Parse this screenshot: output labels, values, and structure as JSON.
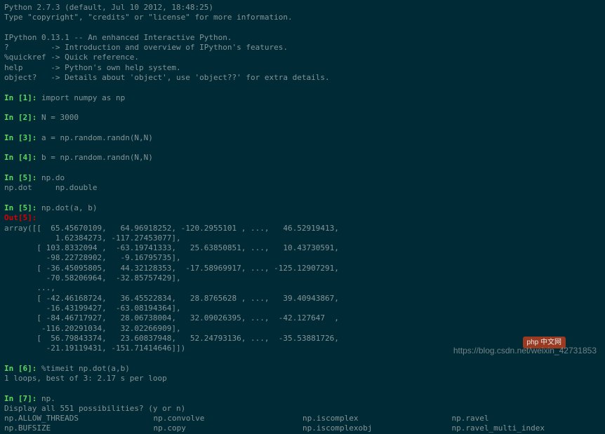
{
  "header": {
    "l1": "Python 2.7.3 (default, Jul 10 2012, 18:48:25)",
    "l2": "Type \"copyright\", \"credits\" or \"license\" for more information.",
    "l3": "",
    "l4": "IPython 0.13.1 -- An enhanced Interactive Python.",
    "l5": "?         -> Introduction and overview of IPython's features.",
    "l6": "%quickref -> Quick reference.",
    "l7": "help      -> Python's own help system.",
    "l8": "object?   -> Details about 'object', use 'object??' for extra details."
  },
  "prompts": {
    "p1": "In [1]: ",
    "c1": "import numpy as np",
    "p2": "In [2]: ",
    "c2": "N = 3000",
    "p3": "In [3]: ",
    "c3": "a = np.random.randn(N,N)",
    "p4": "In [4]: ",
    "c4": "b = np.random.randn(N,N)",
    "p5a": "In [5]: ",
    "c5a": "np.do",
    "comp5": "np.dot     np.double",
    "p5b": "In [5]: ",
    "c5b": "np.dot(a, b)",
    "out5": "Out[5]:",
    "p6": "In [6]: ",
    "c6": "%timeit np.dot(a,b)",
    "time6": "1 loops, best of 3: 2.17 s per loop",
    "p7": "In [7]: ",
    "c7": "np.",
    "display7": "Display all 551 possibilities? (y or n)"
  },
  "array": {
    "l0": "array([[  65.45670109,   64.96918252, -120.2955101 , ...,   46.52919413,",
    "l1": "           1.62384273, -117.27453077],",
    "l2": "       [ 103.8332094 ,  -63.19741333,   25.63850851, ...,   10.43730591,",
    "l3": "         -98.22728902,   -9.16795735],",
    "l4": "       [ -36.45095805,   44.32128353,  -17.58969917, ..., -125.12907291,",
    "l5": "         -70.58206964,  -32.85757429],",
    "l6": "       ...,",
    "l7": "       [ -42.46168724,   36.45522834,   28.8765628 , ...,   39.40943867,",
    "l8": "         -16.43199427,  -63.08194364],",
    "l9": "       [ -84.46717927,   28.06738004,   32.09026395, ...,  -42.127647  ,",
    "l10": "        -116.20291034,   32.02266909],",
    "l11": "       [  56.79843374,   23.60837948,   52.24793136, ...,  -35.53881726,",
    "l12": "         -21.19119431, -151.71414646]])"
  },
  "tabcomp": {
    "r1c1": "np.ALLOW_THREADS",
    "r1c2": "np.convolve",
    "r1c3": "np.iscomplex",
    "r1c4": "np.ravel",
    "r2c1": "np.BUFSIZE",
    "r2c2": "np.copy",
    "r2c3": "np.iscomplexobj",
    "r2c4": "np.ravel_multi_index"
  },
  "watermark": "https://blog.csdn.net/weixin_42731853",
  "logo": "php 中文网"
}
